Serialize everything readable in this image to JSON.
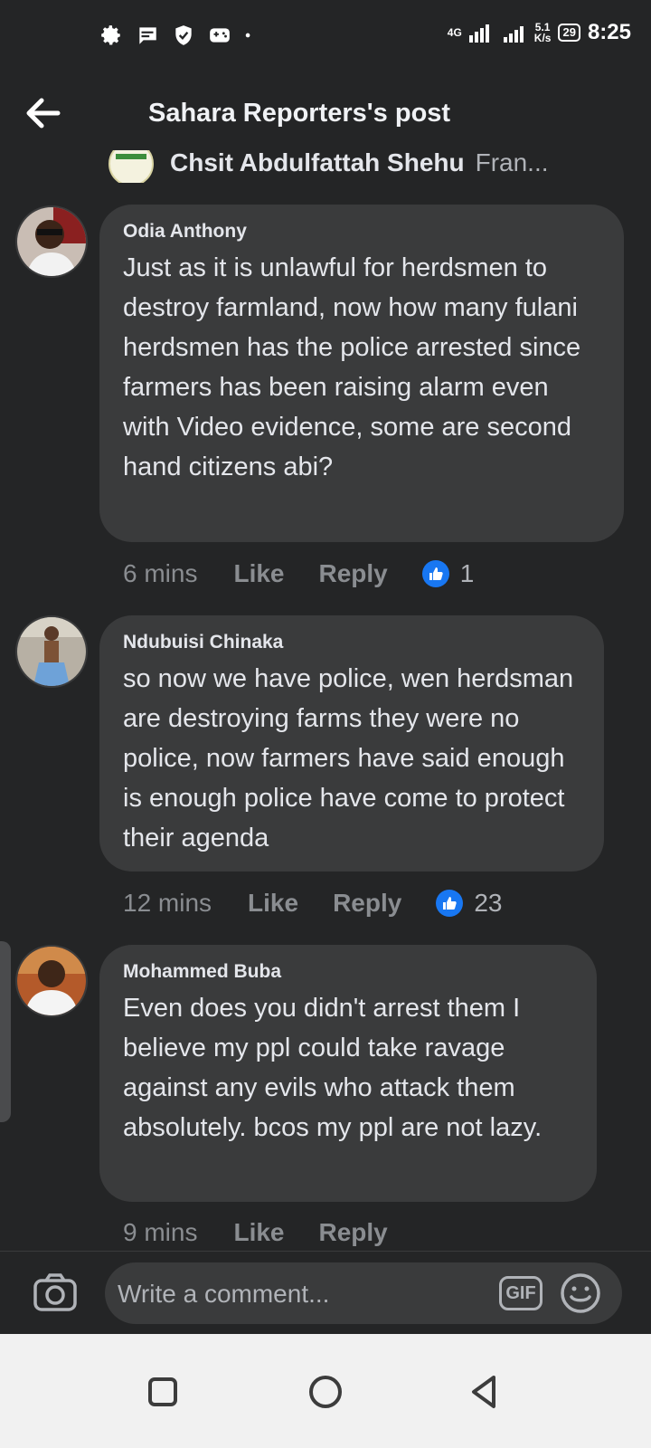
{
  "status_bar": {
    "icons": [
      "settings-icon",
      "message-icon",
      "shield-icon",
      "gamepad-icon",
      "dot-icon"
    ],
    "network": "4G",
    "speed_value": "5.1",
    "speed_unit": "K/s",
    "battery": "29",
    "time": "8:25"
  },
  "header": {
    "back_icon": "arrow-left-icon",
    "title": "Sahara Reporters's post"
  },
  "partial_comment": {
    "author": "Chsit Abdulfattah Shehu",
    "preview": "Fran..."
  },
  "comments": [
    {
      "author": "Odia Anthony",
      "text": "Just as it is unlawful for herdsmen to destroy farmland, now how many fulani herdsmen has the police arrested since farmers has been raising alarm even with Video evidence, some are second hand citizens abi?",
      "time": "6 mins",
      "like_label": "Like",
      "reply_label": "Reply",
      "like_count": "1"
    },
    {
      "author": "Ndubuisi Chinaka",
      "text": "so now we have police, wen herdsman are destroying farms they were no police, now farmers have said enough is enough police have come to protect their agenda",
      "time": "12 mins",
      "like_label": "Like",
      "reply_label": "Reply",
      "like_count": "23"
    },
    {
      "author": "Mohammed Buba",
      "text": "Even does you didn't arrest them I believe my ppl could take ravage against any evils who attack them absolutely. bcos my ppl are not lazy.",
      "time": "9 mins",
      "like_label": "Like",
      "reply_label": "Reply",
      "like_count": ""
    }
  ],
  "composer": {
    "placeholder": "Write a comment...",
    "gif_label": "GIF",
    "camera_icon": "camera-icon",
    "emoji_icon": "emoji-icon"
  },
  "nav_bar": {
    "icons": [
      "recent-apps-icon",
      "home-icon",
      "back-icon"
    ]
  },
  "colors": {
    "background": "#242526",
    "bubble": "#3a3b3c",
    "like_blue": "#1877f2",
    "meta_text": "#8a8d91"
  }
}
